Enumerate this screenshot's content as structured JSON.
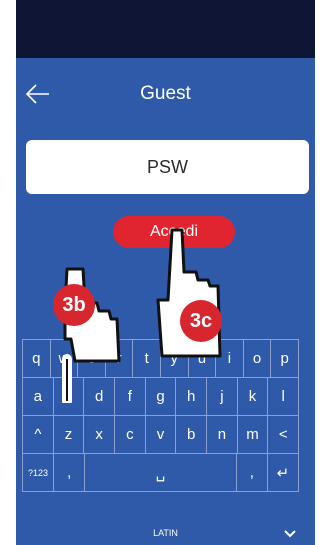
{
  "header": {
    "title": "Guest",
    "back_icon": "arrow-left-icon"
  },
  "password_field": {
    "value": "PSW"
  },
  "login_button": {
    "label": "Accedi"
  },
  "keyboard": {
    "rows": [
      [
        "q",
        "w",
        "e",
        "r",
        "t",
        "y",
        "u",
        "i",
        "o",
        "p"
      ],
      [
        "a",
        "s",
        "d",
        "f",
        "g",
        "h",
        "j",
        "k",
        "l"
      ],
      [
        "^",
        "z",
        "x",
        "c",
        "v",
        "b",
        "n",
        "m",
        "<"
      ],
      [
        "?123",
        ",",
        "␣",
        ",",
        "↵"
      ]
    ],
    "language": "LATIN",
    "collapse_icon": "chevron-down-icon"
  },
  "annotations": [
    {
      "label": "3b"
    },
    {
      "label": "3c"
    }
  ],
  "colors": {
    "background": "#2e5aa9",
    "status_bar": "#0e1535",
    "button": "#e02531",
    "badge": "#d8262f"
  }
}
